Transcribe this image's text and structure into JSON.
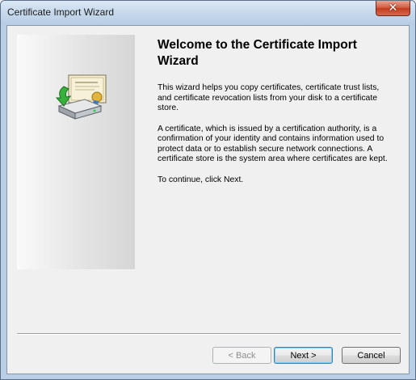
{
  "window": {
    "title": "Certificate Import Wizard",
    "close_icon": "close-icon"
  },
  "wizard": {
    "heading": "Welcome to the Certificate Import Wizard",
    "paragraphs": [
      "This wizard helps you copy certificates, certificate trust lists, and certificate revocation lists from your disk to a certificate store.",
      "A certificate, which is issued by a certification authority, is a confirmation of your identity and contains information used to protect data or to establish secure network connections. A certificate store is the system area where certificates are kept.",
      "To continue, click Next."
    ],
    "icon": "certificate-import-icon"
  },
  "buttons": {
    "back": "< Back",
    "next": "Next >",
    "cancel": "Cancel"
  },
  "colors": {
    "accent": "#3c7fb1",
    "close": "#c43b1c"
  }
}
